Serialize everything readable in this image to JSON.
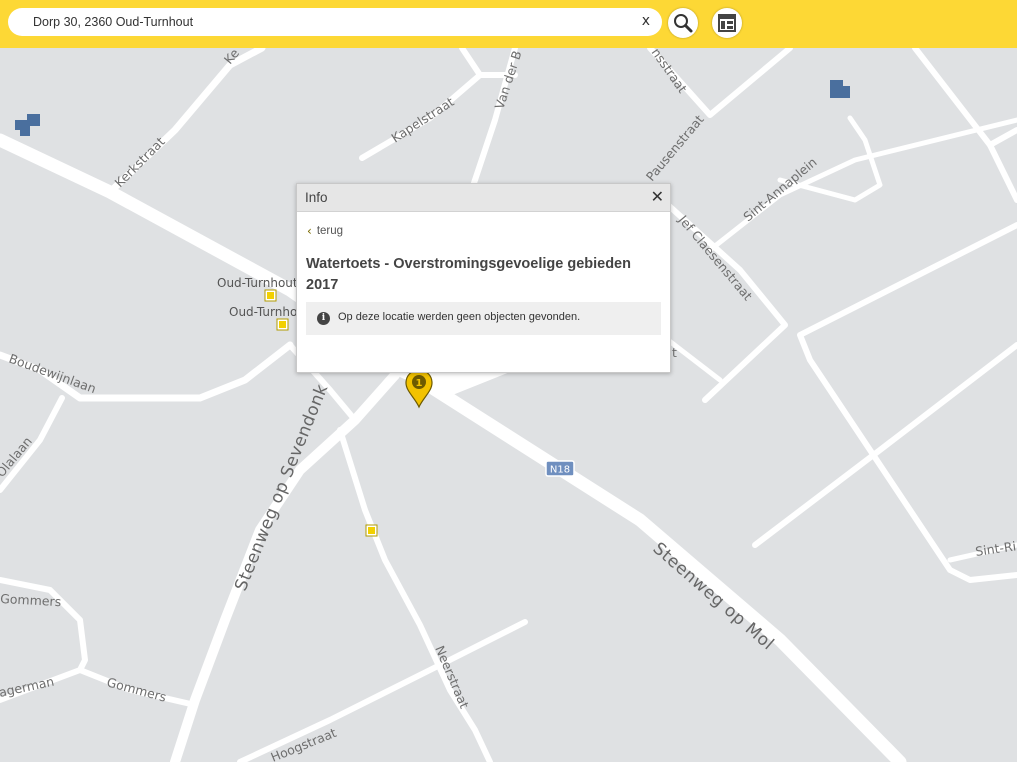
{
  "search": {
    "value": "Dorp 30, 2360 Oud-Turnhout",
    "clear_label": "x"
  },
  "toolbar": {
    "search_icon": "magnifier-icon",
    "layers_icon": "layers-grid-icon"
  },
  "info_panel": {
    "title": "Info",
    "close_label": "✕",
    "back_label": "terug",
    "layer_title": "Watertoets - Overstromingsgevoelige gebieden 2017",
    "message": "Op deze locatie werden geen objecten gevonden.",
    "message_icon": "info-icon"
  },
  "map": {
    "marker_label": "1",
    "marker_color": "#f2c200",
    "building_color": "#4a6f9e",
    "road_badge": "N18",
    "street_labels": {
      "kerkstraat": "Kerkstraat",
      "kerkstraat_top": "Ke",
      "kapelstraat": "Kapelstraat",
      "van_der": "Van der B",
      "pausenstraat": "Pausenstraat",
      "sint_annaplein": "Sint-Annaplein",
      "jef_claesen": "Jef Claesenstraat",
      "boudewijnlaan": "Boudewijnlaan",
      "olalaan": "Olalaan",
      "steenweg_sevendonk": "Steenweg op Sevendonk",
      "steenweg_mol": "Steenweg op Mol",
      "gommers_1": "Gommers",
      "gommers_2": "Gommers",
      "agerman": "agerman",
      "neerstraat": "Neerstraat",
      "hoogstraat": "Hoogstraat",
      "sint_ri": "Sint-Ri",
      "top_street": "nsstraat",
      "partial_t": "t"
    },
    "stops": [
      "Oud-Turnhout",
      "Oud-Turnhout"
    ]
  },
  "colors": {
    "topbar": "#fdd835",
    "map_bg": "#dfe1e3",
    "road": "#ffffff"
  }
}
